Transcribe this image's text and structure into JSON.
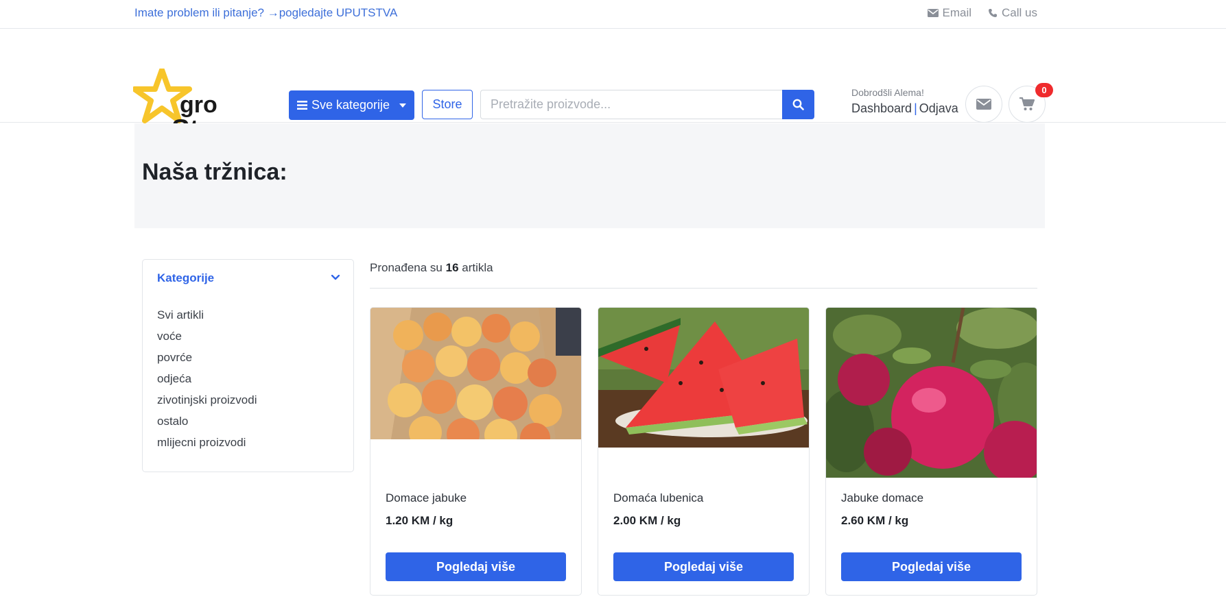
{
  "topbar": {
    "help_text": "Imate problem ili pitanje? →pogledajte UPUTSTVA",
    "email_label": "Email",
    "call_label": "Call us"
  },
  "header": {
    "logo_text": "groStar",
    "categories_button": "Sve kategorije",
    "store_button": "Store",
    "search_placeholder": "Pretražite proizvode...",
    "welcome": "Dobrodšli Alema!",
    "dashboard_link": "Dashboard",
    "separator": "|",
    "logout_link": "Odjava",
    "cart_count": "0",
    "colors": {
      "accent": "#2f64e7",
      "badge": "#ef2b2d",
      "logo_star": "#f7c52b"
    }
  },
  "banner": {
    "title": "Naša tržnica:"
  },
  "sidebar": {
    "heading": "Kategorije",
    "items": [
      {
        "label": "Svi artikli"
      },
      {
        "label": "voće"
      },
      {
        "label": "povrće"
      },
      {
        "label": "odjeća"
      },
      {
        "label": "zivotinjski proizvodi"
      },
      {
        "label": "ostalo"
      },
      {
        "label": "mlijecni proizvodi"
      }
    ]
  },
  "results": {
    "prefix": "Pronađena su",
    "count": "16",
    "suffix": "artikla"
  },
  "products": [
    {
      "name": "Domace jabuke",
      "price": "1.20 KM / kg",
      "button": "Pogledaj više",
      "image": "apples-in-crate"
    },
    {
      "name": "Domaća lubenica",
      "price": "2.00 KM / kg",
      "button": "Pogledaj više",
      "image": "watermelon-slices"
    },
    {
      "name": "Jabuke domace",
      "price": "2.60 KM / kg",
      "button": "Pogledaj više",
      "image": "red-apples-on-tree"
    }
  ]
}
